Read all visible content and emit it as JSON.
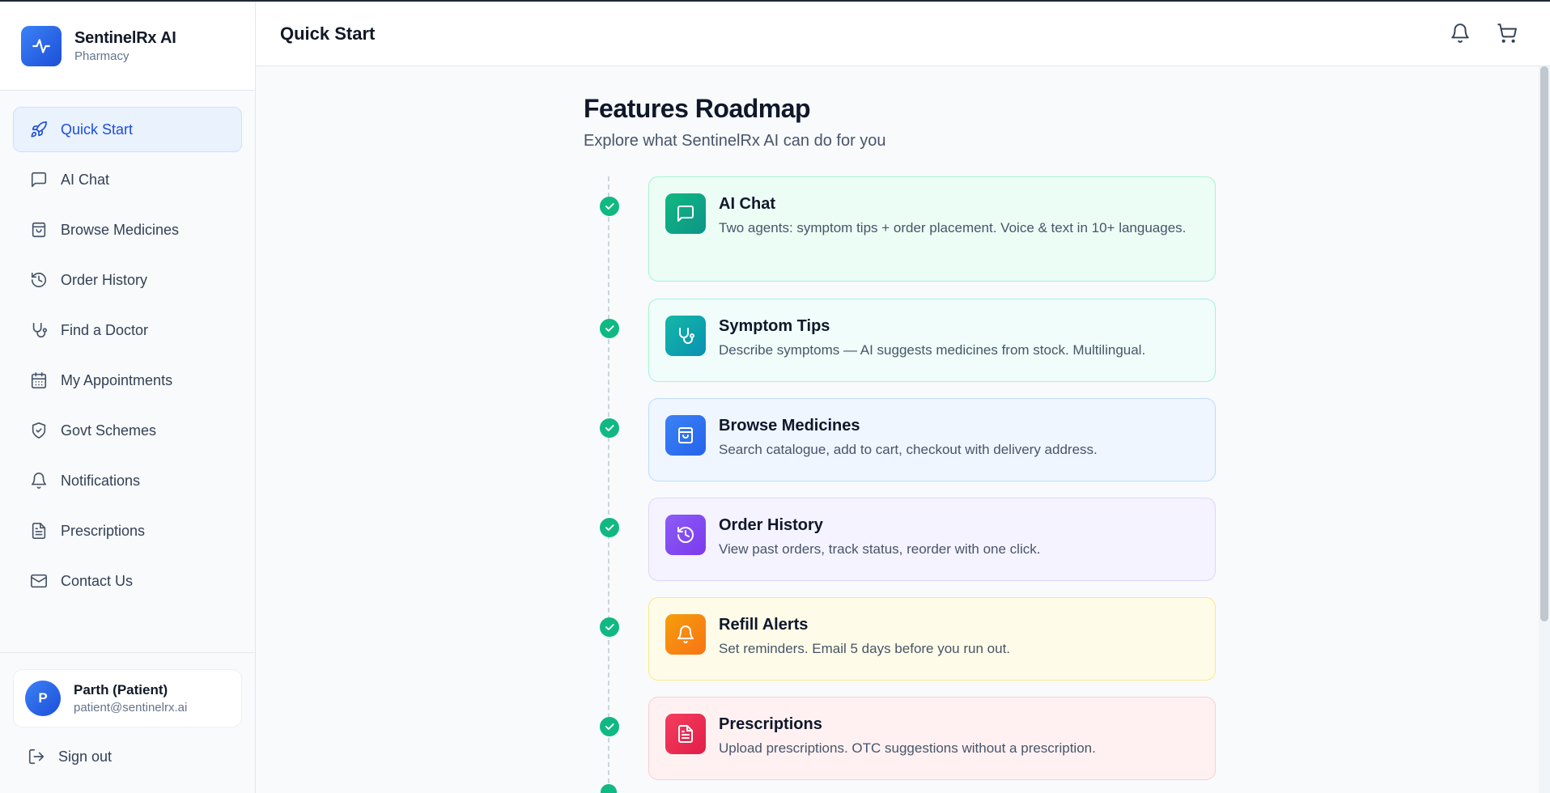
{
  "brand": {
    "title": "SentinelRx AI",
    "subtitle": "Pharmacy"
  },
  "sidebar": {
    "items": [
      {
        "label": "Quick Start",
        "icon": "rocket-icon"
      },
      {
        "label": "AI Chat",
        "icon": "chat-icon"
      },
      {
        "label": "Browse Medicines",
        "icon": "shopping-bag-icon"
      },
      {
        "label": "Order History",
        "icon": "history-icon"
      },
      {
        "label": "Find a Doctor",
        "icon": "stethoscope-icon"
      },
      {
        "label": "My Appointments",
        "icon": "calendar-icon"
      },
      {
        "label": "Govt Schemes",
        "icon": "shield-check-icon"
      },
      {
        "label": "Notifications",
        "icon": "bell-icon"
      },
      {
        "label": "Prescriptions",
        "icon": "file-text-icon"
      },
      {
        "label": "Contact Us",
        "icon": "mail-icon"
      }
    ]
  },
  "user": {
    "initial": "P",
    "name": "Parth (Patient)",
    "email": "patient@sentinelrx.ai"
  },
  "signout_label": "Sign out",
  "header": {
    "title": "Quick Start"
  },
  "roadmap": {
    "title": "Features Roadmap",
    "subtitle": "Explore what SentinelRx AI can do for you",
    "features": [
      {
        "title": "AI Chat",
        "desc": "Two agents: symptom tips + order placement. Voice & text in 10+ languages.",
        "icon": "chat-icon",
        "status": "complete"
      },
      {
        "title": "Symptom Tips",
        "desc": "Describe symptoms — AI suggests medicines from stock. Multilingual.",
        "icon": "stethoscope-icon",
        "status": "complete"
      },
      {
        "title": "Browse Medicines",
        "desc": "Search catalogue, add to cart, checkout with delivery address.",
        "icon": "shopping-bag-icon",
        "status": "complete"
      },
      {
        "title": "Order History",
        "desc": "View past orders, track status, reorder with one click.",
        "icon": "history-icon",
        "status": "complete"
      },
      {
        "title": "Refill Alerts",
        "desc": "Set reminders. Email 5 days before you run out.",
        "icon": "bell-icon",
        "status": "complete"
      },
      {
        "title": "Prescriptions",
        "desc": "Upload prescriptions. OTC suggestions without a prescription.",
        "icon": "file-text-icon",
        "status": "complete"
      }
    ]
  },
  "colors": {
    "accent": "#2563eb",
    "success": "#10b981",
    "ai_chat": "#10b981",
    "symptom_tips": "#14b8a6",
    "browse_medicines": "#3b82f6",
    "order_history": "#8b5cf6",
    "refill_alerts": "#f59e0b",
    "prescriptions": "#f43f5e"
  }
}
